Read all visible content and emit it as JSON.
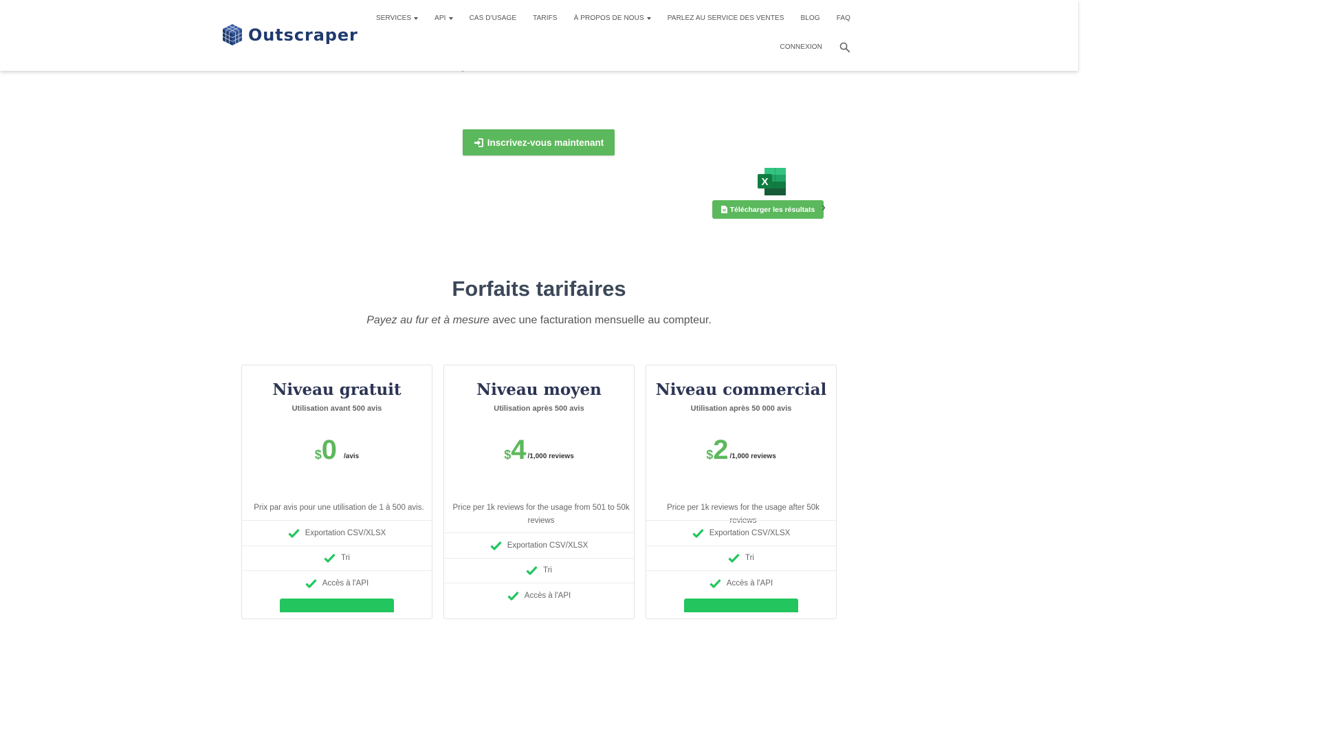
{
  "brand": {
    "name": "Outscraper",
    "logo_color": "#1f3a6e"
  },
  "nav": {
    "row1": [
      {
        "label": "SERVICES",
        "dropdown": true
      },
      {
        "label": "API",
        "dropdown": true
      },
      {
        "label": "CAS D'USAGE",
        "dropdown": false
      },
      {
        "label": "TARIFS",
        "dropdown": false
      },
      {
        "label": "À PROPOS DE NOUS",
        "dropdown": true
      },
      {
        "label": "PARLEZ AU SERVICE DES VENTES",
        "dropdown": false
      },
      {
        "label": "BLOG",
        "dropdown": false
      },
      {
        "label": "FAQ",
        "dropdown": false
      }
    ],
    "row2": [
      {
        "label": "CONNEXION"
      }
    ],
    "search_icon": "search-icon"
  },
  "hero": {
    "signup_label": "Inscrivez-vous maintenant",
    "download_label": "Télécharger les résultats",
    "accent": "#5cb85c"
  },
  "pricing": {
    "title": "Forfaits tarifaires",
    "subtitle_italic": "Payez au fur et à mesure",
    "subtitle_rest": " avec une facturation mensuelle au compteur.",
    "tiers": [
      {
        "name": "Niveau gratuit",
        "usage": "Utilisation avant 500 avis",
        "currency": "$",
        "amount": "0",
        "unit": "/avis",
        "desc": "Prix par avis pour une utilisation de 1 à 500 avis.",
        "features": [
          "Exportation CSV/XLSX",
          "Tri",
          "Accès à l'API"
        ]
      },
      {
        "name": "Niveau moyen",
        "usage": "Utilisation après 500 avis",
        "currency": "$",
        "amount": "4",
        "unit": "/1,000 reviews",
        "desc": "Price per 1k reviews for the usage from 501 to 50k reviews",
        "features": [
          "Exportation CSV/XLSX",
          "Tri",
          "Accès à l'API"
        ]
      },
      {
        "name": "Niveau commercial",
        "usage": "Utilisation après 50 000 avis",
        "currency": "$",
        "amount": "2",
        "unit": "/1,000 reviews",
        "desc": "Price per 1k reviews for the usage after 50k reviews",
        "features": [
          "Exportation CSV/XLSX",
          "Tri",
          "Accès à l'API"
        ]
      }
    ],
    "check_color": "#22c55e"
  }
}
